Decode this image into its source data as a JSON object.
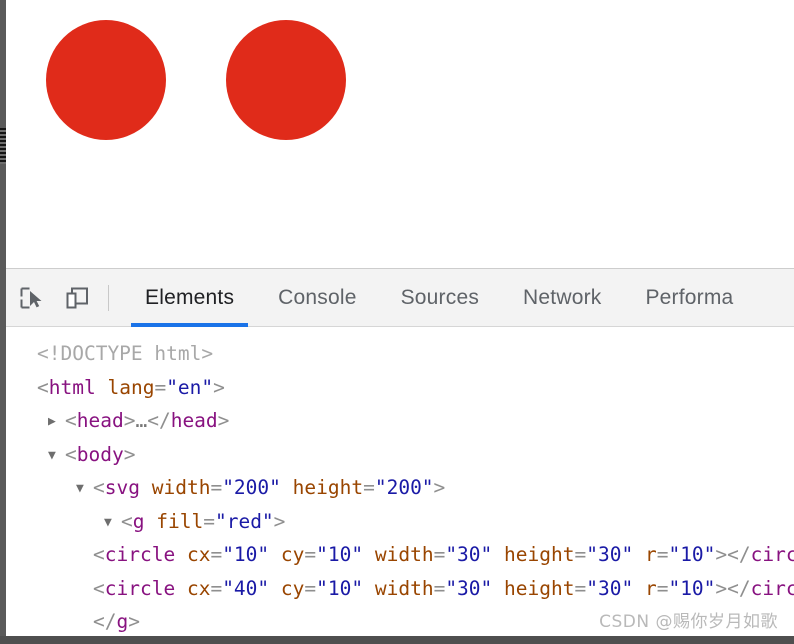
{
  "colors": {
    "circle_fill": "#e02b1a",
    "active_tab_underline": "#1a73e8",
    "toolbar_background": "#f3f3f3",
    "tag_color": "#881280",
    "attribute_color": "#994500",
    "value_color": "#1a1aa6",
    "doctype_color": "#a8a8a8"
  },
  "viewport": {
    "svg": {
      "width": "200",
      "height": "200",
      "group_fill": "red",
      "circles": [
        {
          "cx": "10",
          "cy": "10",
          "width": "30",
          "height": "30",
          "r": "10"
        },
        {
          "cx": "40",
          "cy": "10",
          "width": "30",
          "height": "30",
          "r": "10"
        }
      ]
    }
  },
  "devtools": {
    "toolbar": {
      "inspect_icon": "inspect-element-icon",
      "device_icon": "device-toolbar-icon"
    },
    "tabs": [
      {
        "label": "Elements",
        "active": true
      },
      {
        "label": "Console",
        "active": false
      },
      {
        "label": "Sources",
        "active": false
      },
      {
        "label": "Network",
        "active": false
      },
      {
        "label": "Performa",
        "active": false
      }
    ],
    "dom_tree": [
      {
        "id": "doctype",
        "twisty": "",
        "indent": "ind1",
        "parts": [
          {
            "text": "<!DOCTYPE html>",
            "cls": "doctype"
          }
        ]
      },
      {
        "id": "html-open",
        "twisty": "",
        "indent": "ind1",
        "parts": [
          {
            "text": "<",
            "cls": "pnct"
          },
          {
            "text": "html",
            "cls": "tag"
          },
          {
            "text": " ",
            "cls": "pnct"
          },
          {
            "text": "lang",
            "cls": "attr"
          },
          {
            "text": "=",
            "cls": "pnct"
          },
          {
            "text": "\"en\"",
            "cls": "val"
          },
          {
            "text": ">",
            "cls": "pnct"
          }
        ]
      },
      {
        "id": "head-collapsed",
        "twisty": "▶",
        "indent": "ind2",
        "parts": [
          {
            "text": "<",
            "cls": "pnct"
          },
          {
            "text": "head",
            "cls": "tag"
          },
          {
            "text": ">",
            "cls": "pnct"
          },
          {
            "text": "…",
            "cls": "ellip"
          },
          {
            "text": "</",
            "cls": "pnct"
          },
          {
            "text": "head",
            "cls": "tag"
          },
          {
            "text": ">",
            "cls": "pnct"
          }
        ]
      },
      {
        "id": "body-open",
        "twisty": "▼",
        "indent": "ind2",
        "parts": [
          {
            "text": "<",
            "cls": "pnct"
          },
          {
            "text": "body",
            "cls": "tag"
          },
          {
            "text": ">",
            "cls": "pnct"
          }
        ]
      },
      {
        "id": "svg-open",
        "twisty": "▼",
        "indent": "ind3",
        "parts": [
          {
            "text": "<",
            "cls": "pnct"
          },
          {
            "text": "svg",
            "cls": "tag"
          },
          {
            "text": " ",
            "cls": "pnct"
          },
          {
            "text": "width",
            "cls": "attr"
          },
          {
            "text": "=",
            "cls": "pnct"
          },
          {
            "text": "\"200\"",
            "cls": "val"
          },
          {
            "text": " ",
            "cls": "pnct"
          },
          {
            "text": "height",
            "cls": "attr"
          },
          {
            "text": "=",
            "cls": "pnct"
          },
          {
            "text": "\"200\"",
            "cls": "val"
          },
          {
            "text": ">",
            "cls": "pnct"
          }
        ]
      },
      {
        "id": "g-open",
        "twisty": "▼",
        "indent": "ind4",
        "parts": [
          {
            "text": "<",
            "cls": "pnct"
          },
          {
            "text": "g",
            "cls": "tag"
          },
          {
            "text": " ",
            "cls": "pnct"
          },
          {
            "text": "fill",
            "cls": "attr"
          },
          {
            "text": "=",
            "cls": "pnct"
          },
          {
            "text": "\"red\"",
            "cls": "val"
          },
          {
            "text": ">",
            "cls": "pnct"
          }
        ]
      },
      {
        "id": "circle-1",
        "twisty": "",
        "indent": "ind5",
        "extra_indent": 52,
        "parts": [
          {
            "text": "<",
            "cls": "pnct"
          },
          {
            "text": "circle",
            "cls": "tag"
          },
          {
            "text": " ",
            "cls": "pnct"
          },
          {
            "text": "cx",
            "cls": "attr"
          },
          {
            "text": "=",
            "cls": "pnct"
          },
          {
            "text": "\"10\"",
            "cls": "val"
          },
          {
            "text": " ",
            "cls": "pnct"
          },
          {
            "text": "cy",
            "cls": "attr"
          },
          {
            "text": "=",
            "cls": "pnct"
          },
          {
            "text": "\"10\"",
            "cls": "val"
          },
          {
            "text": " ",
            "cls": "pnct"
          },
          {
            "text": "width",
            "cls": "attr"
          },
          {
            "text": "=",
            "cls": "pnct"
          },
          {
            "text": "\"30\"",
            "cls": "val"
          },
          {
            "text": " ",
            "cls": "pnct"
          },
          {
            "text": "height",
            "cls": "attr"
          },
          {
            "text": "=",
            "cls": "pnct"
          },
          {
            "text": "\"30\"",
            "cls": "val"
          },
          {
            "text": " ",
            "cls": "pnct"
          },
          {
            "text": "r",
            "cls": "attr"
          },
          {
            "text": "=",
            "cls": "pnct"
          },
          {
            "text": "\"10\"",
            "cls": "val"
          },
          {
            "text": "></",
            "cls": "pnct"
          },
          {
            "text": "circle",
            "cls": "tag"
          },
          {
            "text": ">",
            "cls": "pnct"
          }
        ]
      },
      {
        "id": "circle-2",
        "twisty": "",
        "indent": "ind5",
        "extra_indent": 52,
        "parts": [
          {
            "text": "<",
            "cls": "pnct"
          },
          {
            "text": "circle",
            "cls": "tag"
          },
          {
            "text": " ",
            "cls": "pnct"
          },
          {
            "text": "cx",
            "cls": "attr"
          },
          {
            "text": "=",
            "cls": "pnct"
          },
          {
            "text": "\"40\"",
            "cls": "val"
          },
          {
            "text": " ",
            "cls": "pnct"
          },
          {
            "text": "cy",
            "cls": "attr"
          },
          {
            "text": "=",
            "cls": "pnct"
          },
          {
            "text": "\"10\"",
            "cls": "val"
          },
          {
            "text": " ",
            "cls": "pnct"
          },
          {
            "text": "width",
            "cls": "attr"
          },
          {
            "text": "=",
            "cls": "pnct"
          },
          {
            "text": "\"30\"",
            "cls": "val"
          },
          {
            "text": " ",
            "cls": "pnct"
          },
          {
            "text": "height",
            "cls": "attr"
          },
          {
            "text": "=",
            "cls": "pnct"
          },
          {
            "text": "\"30\"",
            "cls": "val"
          },
          {
            "text": " ",
            "cls": "pnct"
          },
          {
            "text": "r",
            "cls": "attr"
          },
          {
            "text": "=",
            "cls": "pnct"
          },
          {
            "text": "\"10\"",
            "cls": "val"
          },
          {
            "text": "></",
            "cls": "pnct"
          },
          {
            "text": "circle",
            "cls": "tag"
          },
          {
            "text": ">",
            "cls": "pnct"
          }
        ]
      },
      {
        "id": "g-close",
        "twisty": "",
        "indent": "ind5",
        "extra_indent": 16,
        "parts": [
          {
            "text": "</",
            "cls": "pnct"
          },
          {
            "text": "g",
            "cls": "tag"
          },
          {
            "text": ">",
            "cls": "pnct"
          }
        ]
      }
    ]
  },
  "watermark": {
    "text": "CSDN @赐你岁月如歌"
  }
}
